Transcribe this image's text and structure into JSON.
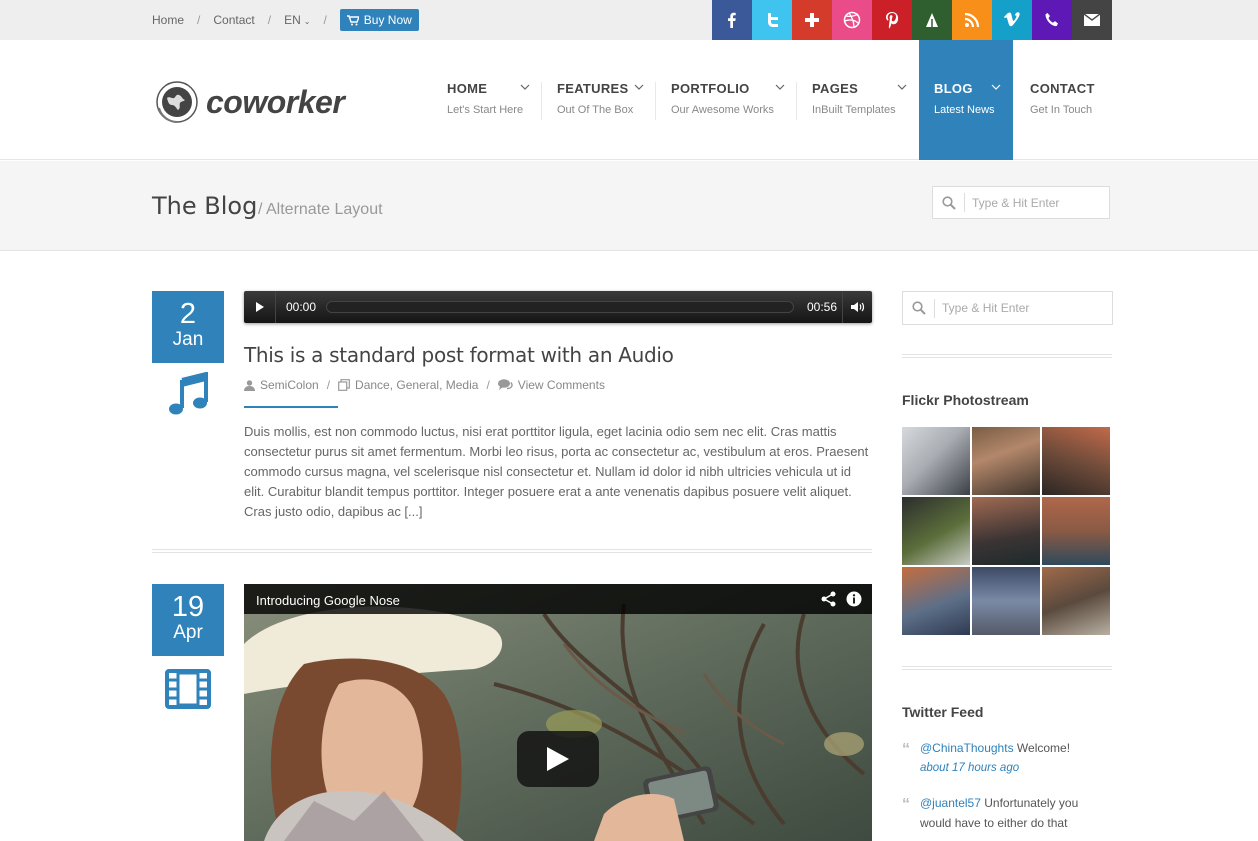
{
  "topbar": {
    "links": [
      "Home",
      "Contact"
    ],
    "language": "EN",
    "buy_label": "Buy Now"
  },
  "social": [
    {
      "icon": "facebook-icon",
      "color": "#3b5998"
    },
    {
      "icon": "twitter-icon",
      "color": "#3fc4ef"
    },
    {
      "icon": "google-plus-icon",
      "color": "#d43b2a"
    },
    {
      "icon": "dribbble-icon",
      "color": "#ea4c89"
    },
    {
      "icon": "pinterest-icon",
      "color": "#cb2027"
    },
    {
      "icon": "forrst-icon",
      "color": "#2f5f2f"
    },
    {
      "icon": "rss-icon",
      "color": "#f88f19"
    },
    {
      "icon": "vimeo-icon",
      "color": "#14a0c8"
    },
    {
      "icon": "phone-icon",
      "color": "#5d18b5"
    },
    {
      "icon": "email-icon",
      "color": "#444444"
    }
  ],
  "logo": {
    "text": "coworker"
  },
  "nav": [
    {
      "title": "HOME",
      "sub": "Let's Start Here"
    },
    {
      "title": "FEATURES",
      "sub": "Out Of The Box"
    },
    {
      "title": "PORTFOLIO",
      "sub": "Our Awesome Works"
    },
    {
      "title": "PAGES",
      "sub": "InBuilt Templates"
    },
    {
      "title": "BLOG",
      "sub": "Latest News"
    },
    {
      "title": "CONTACT",
      "sub": "Get In Touch"
    }
  ],
  "page_title": {
    "title": "The Blog",
    "subtitle": "/ Alternate Layout",
    "search_placeholder": "Type & Hit Enter"
  },
  "posts": [
    {
      "day": "2",
      "month": "Jan",
      "format_icon": "music-icon",
      "audio": {
        "current": "00:00",
        "duration": "00:56"
      },
      "title": "This is a standard post format with an Audio",
      "author": "SemiColon",
      "categories": "Dance, General, Media",
      "comments": "View Comments",
      "excerpt": "Duis mollis, est non commodo luctus, nisi erat porttitor ligula, eget lacinia odio sem nec elit. Cras mattis consectetur purus sit amet fermentum. Morbi leo risus, porta ac consectetur ac, vestibulum at eros. Praesent commodo cursus magna, vel scelerisque nisl consectetur et. Nullam id dolor id nibh ultricies vehicula ut id elit. Curabitur blandit tempus porttitor. Integer posuere erat a ante venenatis dapibus posuere velit aliquet. Cras justo odio, dapibus ac [...]"
    },
    {
      "day": "19",
      "month": "Apr",
      "format_icon": "film-icon",
      "video_title": "Introducing Google Nose"
    }
  ],
  "sidebar": {
    "search_placeholder": "Type & Hit Enter",
    "flickr_title": "Flickr Photostream",
    "twitter_title": "Twitter Feed",
    "tweets": [
      {
        "user": "@ChinaThoughts",
        "text": " Welcome!",
        "time": "about 17 hours ago"
      },
      {
        "user": "@juantel57",
        "text": " Unfortunately you would have to either do that",
        "time": ""
      }
    ]
  },
  "colors": {
    "accent": "#2f82ba"
  }
}
